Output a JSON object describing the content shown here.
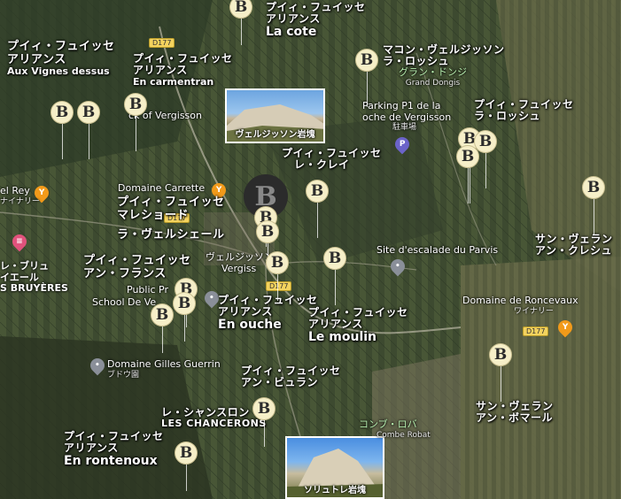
{
  "map": {
    "roads": [
      "D177",
      "D177",
      "D177",
      "D177"
    ],
    "wine_labels": [
      {
        "ja": "プイィ・フュイッセ",
        "ja2": "アリアンス",
        "fr": "La cote"
      },
      {
        "ja": "プイィ・フュイッセ",
        "ja2": "アリアンス",
        "fr": "Aux Vignes dessus"
      },
      {
        "ja": "プイィ・フュイッセ",
        "ja2": "アリアンス",
        "fr": "En carmentran"
      },
      {
        "ja": "マコン・ヴェルジッソン",
        "ja2": "ラ・ロッシュ",
        "fr": ""
      },
      {
        "ja": "プイィ・フュイッセ",
        "ja2": "ラ・ロッシュ",
        "fr": ""
      },
      {
        "ja": "プイィ・フュイッセ",
        "ja2": "レ・クレイ",
        "fr": ""
      },
      {
        "ja": "プイィ・フュイッセ",
        "ja2": "マレショード",
        "fr": ""
      },
      {
        "ja": "ラ・ヴェルシェール",
        "ja2": "",
        "fr": ""
      },
      {
        "ja": "プイィ・フュイッセ",
        "ja2": "アン・フランス",
        "fr": ""
      },
      {
        "ja": "プイィ・フュイッセ",
        "ja2": "アリアンス",
        "fr": "En ouche"
      },
      {
        "ja": "プイィ・フュイッセ",
        "ja2": "アリアンス",
        "fr": "Le moulin"
      },
      {
        "ja": "サン・ヴェラン",
        "ja2": "アン・クレシュ",
        "fr": ""
      },
      {
        "ja": "プイィ・フュイッセ",
        "ja2": "アン・ビュラン",
        "fr": ""
      },
      {
        "ja": "サン・ヴェラン",
        "ja2": "アン・ボマール",
        "fr": ""
      },
      {
        "ja": "レ・シャンスロン",
        "ja2": "",
        "fr": "LES CHANCERONS"
      },
      {
        "ja": "プイィ・フュイッセ",
        "ja2": "アリアンス",
        "fr": "En rontenoux"
      }
    ],
    "places": {
      "grand_dongis_ja": "グラン・ドンジ",
      "grand_dongis": "Grand Dongis",
      "parking": "Parking P1 de la",
      "parking2": "oche de Vergisson",
      "parking_sub": "駐車場",
      "rock_vergisson": "ck of Vergisson",
      "rel_rey": "el Rey",
      "rel_rey_sub": "ナイナリー",
      "carrette": "Domaine Carrette",
      "carrette_sub": "ワイナリー",
      "vergisson": "ヴェルジッソン",
      "vergisson2": "Vergiss",
      "escalade": "Site d'escalade du Parvis",
      "bruyeres_ja": "レ・ブリュ",
      "bruyeres_ja2": "イエール",
      "bruyeres": "S BRUYÈRES",
      "public_pr": "Public Pr",
      "school": "School De Ve",
      "roncevaux": "Domaine de Roncevaux",
      "roncevaux_sub": "ワイナリー",
      "guerrin": "Domaine Gilles Guerrin",
      "guerrin_sub": "ブドウ園",
      "combe_ja": "コンブ・ロバ",
      "combe": "Combe Robat"
    },
    "photos": [
      {
        "caption": "ヴェルジッソン岩塊"
      },
      {
        "caption": "ソリュトレ岩塊"
      }
    ],
    "markers": {
      "glyph": "ẞ",
      "count": 24
    },
    "colors": {
      "marker_fill": "#f6efc8",
      "road_badge": "#f4d35e",
      "pin_purple": "#6b63c9",
      "pin_orange": "#f29a1a",
      "pin_pink": "#e1527c",
      "pin_gray": "#8a8f99"
    }
  }
}
